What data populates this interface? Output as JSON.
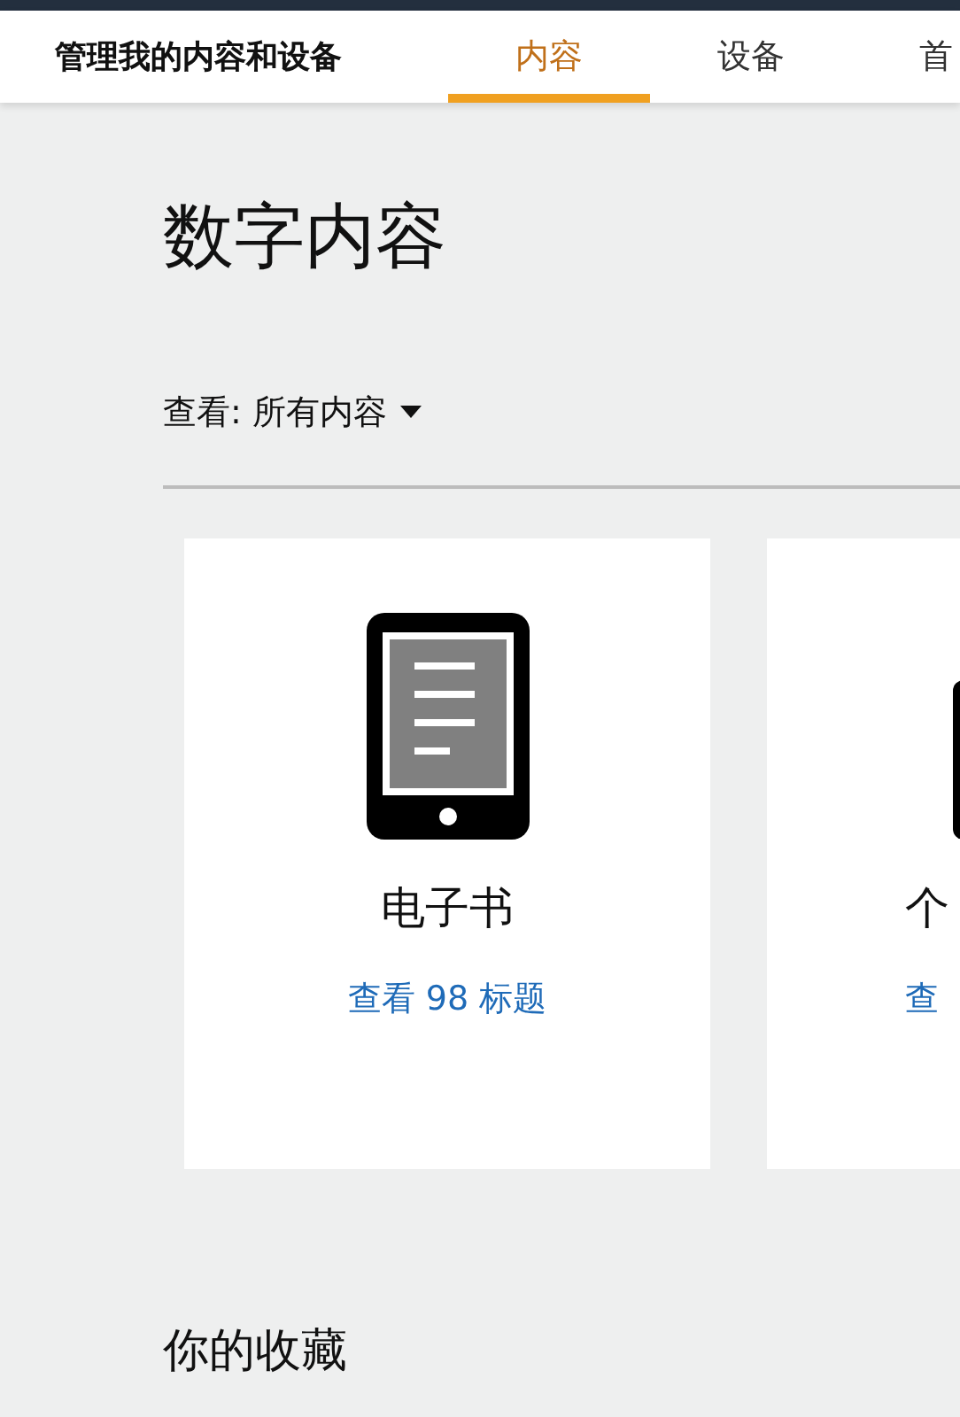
{
  "nav": {
    "title": "管理我的内容和设备",
    "tabs": [
      {
        "label": "内容",
        "selected": true
      },
      {
        "label": "设备",
        "selected": false
      },
      {
        "label": "首",
        "selected": false
      }
    ]
  },
  "page": {
    "heading": "数字内容",
    "filter": "查看: 所有内容"
  },
  "cards": [
    {
      "kind": "ebook",
      "title": "电子书",
      "link": "查看 98 标题"
    },
    {
      "kind": "cut",
      "title": "个",
      "link": "查"
    }
  ],
  "section": {
    "heading": "你的收藏"
  }
}
